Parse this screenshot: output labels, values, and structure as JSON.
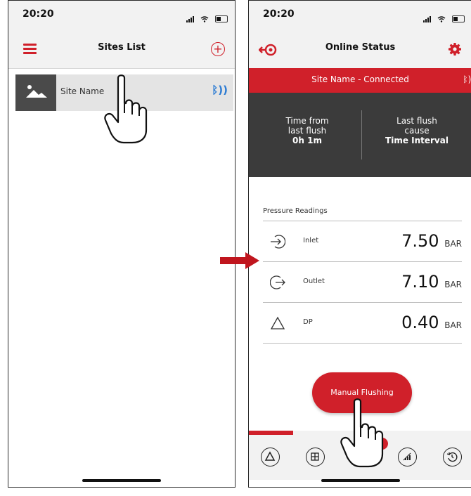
{
  "left_screen": {
    "status": {
      "time": "20:20"
    },
    "nav": {
      "title": "Sites List",
      "menu_icon": "hamburger-menu-icon",
      "add_icon": "plus-circle-icon"
    },
    "sites": [
      {
        "name": "Site Name",
        "thumbnail_icon": "image-placeholder-icon",
        "connection_icon": "bluetooth-icon"
      }
    ]
  },
  "right_screen": {
    "status": {
      "time": "20:20"
    },
    "nav": {
      "title": "Online Status",
      "back_icon": "disconnect-icon",
      "settings_icon": "gear-icon"
    },
    "banner": {
      "text": "Site Name - Connected",
      "bt_icon": "bluetooth-icon"
    },
    "flush_info": {
      "time_label_1": "Time from",
      "time_label_2": "last flush",
      "time_value": "0h 1m",
      "cause_label_1": "Last flush",
      "cause_label_2": "cause",
      "cause_value": "Time Interval"
    },
    "pressure": {
      "section_label": "Pressure Readings",
      "readings": [
        {
          "label": "Inlet",
          "value": "7.50",
          "unit": "BAR",
          "icon": "inlet-arrow-icon"
        },
        {
          "label": "Outlet",
          "value": "7.10",
          "unit": "BAR",
          "icon": "outlet-arrow-icon"
        },
        {
          "label": "DP",
          "value": "0.40",
          "unit": "BAR",
          "icon": "delta-icon"
        }
      ]
    },
    "manual_button": {
      "label": "Manual Flushing"
    },
    "tabs": [
      {
        "icon": "delta-icon"
      },
      {
        "icon": "grid-icon"
      },
      {
        "icon": "flush-icon"
      },
      {
        "icon": "signal-icon"
      },
      {
        "icon": "history-icon"
      }
    ]
  },
  "colors": {
    "accent": "#d0202a",
    "dark_panel": "#3b3b3b",
    "bluetooth": "#2b7bd3"
  }
}
